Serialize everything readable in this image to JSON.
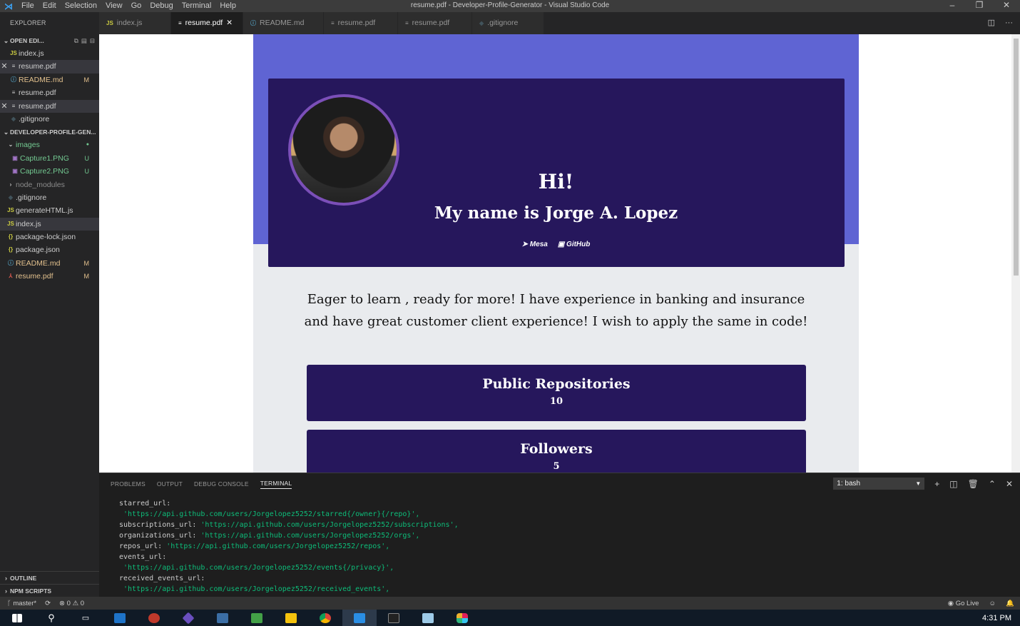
{
  "window": {
    "title": "resume.pdf - Developer-Profile-Generator - Visual Studio Code",
    "menu": [
      "File",
      "Edit",
      "Selection",
      "View",
      "Go",
      "Debug",
      "Terminal",
      "Help"
    ]
  },
  "explorer": {
    "header": "EXPLORER",
    "open_editors_label": "OPEN EDI...",
    "open_editors": [
      {
        "name": "index.js",
        "icon": "JS"
      },
      {
        "name": "resume.pdf",
        "icon": "≡",
        "close": "✕"
      },
      {
        "name": "README.md",
        "icon": "ⓘ",
        "badge": "M"
      },
      {
        "name": "resume.pdf",
        "icon": "≡"
      },
      {
        "name": "resume.pdf",
        "icon": "≡",
        "close": "✕"
      },
      {
        "name": ".gitignore",
        "icon": "◆"
      }
    ],
    "project_label": "DEVELOPER-PROFILE-GEN...",
    "files": [
      {
        "name": "images",
        "icon": "›",
        "badge": "●"
      },
      {
        "name": "Capture1.PNG",
        "icon": "▣",
        "badge": "U"
      },
      {
        "name": "Capture2.PNG",
        "icon": "▣",
        "badge": "U"
      },
      {
        "name": "node_modules",
        "icon": "›"
      },
      {
        "name": ".gitignore",
        "icon": "◆"
      },
      {
        "name": "generateHTML.js",
        "icon": "JS"
      },
      {
        "name": "index.js",
        "icon": "JS"
      },
      {
        "name": "package-lock.json",
        "icon": "{}"
      },
      {
        "name": "package.json",
        "icon": "{}"
      },
      {
        "name": "README.md",
        "icon": "ⓘ",
        "badge": "M"
      },
      {
        "name": "resume.pdf",
        "icon": "⅄",
        "badge": "M"
      }
    ],
    "outline_label": "OUTLINE",
    "npm_label": "NPM SCRIPTS"
  },
  "tabs": [
    {
      "label": "index.js",
      "icon": "JS"
    },
    {
      "label": "resume.pdf",
      "icon": "≡",
      "close": "✕"
    },
    {
      "label": "README.md",
      "icon": "ⓘ"
    },
    {
      "label": "resume.pdf",
      "icon": "≡"
    },
    {
      "label": "resume.pdf",
      "icon": "≡"
    },
    {
      "label": ".gitignore",
      "icon": "◆"
    }
  ],
  "resume": {
    "greeting": "Hi!",
    "name": "My name is Jorge A. Lopez",
    "location_link": "Mesa",
    "github_link": "GitHub",
    "bio": "Eager to learn , ready for more! I have experience in banking and insurance and have great customer client experience! I wish to apply the same in code!",
    "stats": [
      {
        "title": "Public Repositories",
        "value": "10"
      },
      {
        "title": "Followers",
        "value": "5"
      }
    ]
  },
  "panel": {
    "tabs": [
      "PROBLEMS",
      "OUTPUT",
      "DEBUG CONSOLE",
      "TERMINAL"
    ],
    "terminal_select": "1: bash",
    "lines": [
      {
        "key": "starred_url:",
        "val": ""
      },
      {
        "key": "",
        "val": " 'https://api.github.com/users/Jorgelopez5252/starred{/owner}{/repo}',"
      },
      {
        "key": "subscriptions_url: ",
        "val": "'https://api.github.com/users/Jorgelopez5252/subscriptions',"
      },
      {
        "key": "organizations_url: ",
        "val": "'https://api.github.com/users/Jorgelopez5252/orgs',"
      },
      {
        "key": "repos_url: ",
        "val": "'https://api.github.com/users/Jorgelopez5252/repos',"
      },
      {
        "key": "events_url:",
        "val": ""
      },
      {
        "key": "",
        "val": " 'https://api.github.com/users/Jorgelopez5252/events{/privacy}',"
      },
      {
        "key": "received_events_url:",
        "val": ""
      },
      {
        "key": "",
        "val": " 'https://api.github.com/users/Jorgelopez5252/received_events',"
      }
    ]
  },
  "statusbar": {
    "branch": "master*",
    "problems": "⊗ 0 ⚠ 0",
    "go_live": "Go Live"
  },
  "taskbar": {
    "clock": "4:31 PM",
    "icons": [
      "windows-start",
      "search",
      "task-view",
      "file-app",
      "chrome-like",
      "git-app",
      "mysql-app",
      "node-app",
      "file-explorer",
      "chrome",
      "vscode",
      "terminal",
      "notepad",
      "slack"
    ]
  },
  "colors": {
    "accent_band": "#5f64d3",
    "card": "#26175c",
    "terminal_string": "#0dbc79"
  }
}
